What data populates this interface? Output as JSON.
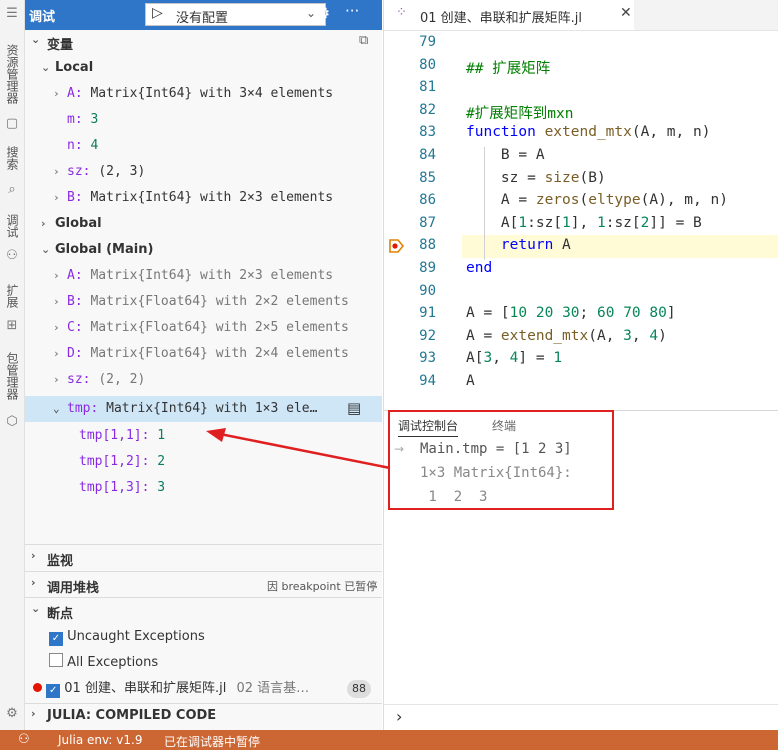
{
  "activity_bar": {
    "labels": [
      "资源管理器",
      "搜索",
      "调试",
      "扩展",
      "包管理器"
    ]
  },
  "debug_toolbar": {
    "title": "调试",
    "config_value": "没有配置"
  },
  "variables": {
    "header": "变量",
    "local_header": "Local",
    "local": [
      {
        "name": "A:",
        "value": "Matrix{Int64} with 3×4 elements"
      },
      {
        "name": "m:",
        "value": "3"
      },
      {
        "name": "n:",
        "value": "4"
      },
      {
        "name": "sz:",
        "value": "(2, 3)"
      },
      {
        "name": "B:",
        "value": "Matrix{Int64} with 2×3 elements"
      }
    ],
    "global_header": "Global",
    "global_main_header": "Global (Main)",
    "global_main": [
      {
        "name": "A:",
        "value": "Matrix{Int64} with 2×3 elements"
      },
      {
        "name": "B:",
        "value": "Matrix{Float64} with 2×2 elements"
      },
      {
        "name": "C:",
        "value": "Matrix{Float64} with 2×5 elements"
      },
      {
        "name": "D:",
        "value": "Matrix{Float64} with 2×4 elements"
      },
      {
        "name": "sz:",
        "value": "(2, 2)"
      }
    ],
    "tmp_row": {
      "name": "tmp:",
      "value": "Matrix{Int64} with 1×3 ele…"
    },
    "tmp_children": [
      {
        "name": "tmp[1,1]:",
        "value": "1"
      },
      {
        "name": "tmp[1,2]:",
        "value": "2"
      },
      {
        "name": "tmp[1,3]:",
        "value": "3"
      }
    ]
  },
  "sections": {
    "watch": "监视",
    "callstack": "调用堆栈",
    "callstack_status": "因 breakpoint 已暂停",
    "breakpoints": "断点",
    "bp_uncaught": "Uncaught Exceptions",
    "bp_all": "All Exceptions",
    "bp_file": "01 创建、串联和扩展矩阵.jl",
    "bp_file_dir": "02 语言基…",
    "bp_line": "88",
    "compiled": "JULIA: COMPILED CODE"
  },
  "editor": {
    "tab_title": "01 创建、串联和扩展矩阵.jl",
    "lines": [
      {
        "n": "79",
        "parts": []
      },
      {
        "n": "80",
        "parts": [
          {
            "t": "## 扩展矩阵",
            "c": "cmt"
          }
        ]
      },
      {
        "n": "81",
        "parts": []
      },
      {
        "n": "82",
        "parts": [
          {
            "t": "#扩展矩阵到mxn",
            "c": "cmt"
          }
        ]
      },
      {
        "n": "83",
        "parts": [
          {
            "t": "function ",
            "c": "kw"
          },
          {
            "t": "extend_mtx",
            "c": "fn"
          },
          {
            "t": "(A, m, n)",
            "c": ""
          }
        ]
      },
      {
        "n": "84",
        "parts": [
          {
            "t": "    B = A",
            "c": ""
          }
        ]
      },
      {
        "n": "85",
        "parts": [
          {
            "t": "    sz = ",
            "c": ""
          },
          {
            "t": "size",
            "c": "fn"
          },
          {
            "t": "(B)",
            "c": ""
          }
        ]
      },
      {
        "n": "86",
        "parts": [
          {
            "t": "    A = ",
            "c": ""
          },
          {
            "t": "zeros",
            "c": "fn"
          },
          {
            "t": "(",
            "c": ""
          },
          {
            "t": "eltype",
            "c": "fn"
          },
          {
            "t": "(A), m, n)",
            "c": ""
          }
        ]
      },
      {
        "n": "87",
        "parts": [
          {
            "t": "    A[",
            "c": ""
          },
          {
            "t": "1",
            "c": "num"
          },
          {
            "t": ":sz[",
            "c": ""
          },
          {
            "t": "1",
            "c": "num"
          },
          {
            "t": "], ",
            "c": ""
          },
          {
            "t": "1",
            "c": "num"
          },
          {
            "t": ":sz[",
            "c": ""
          },
          {
            "t": "2",
            "c": "num"
          },
          {
            "t": "]] = B",
            "c": ""
          }
        ]
      },
      {
        "n": "88",
        "parts": [
          {
            "t": "    ",
            "c": ""
          },
          {
            "t": "return",
            "c": "kw"
          },
          {
            "t": " A",
            "c": ""
          }
        ]
      },
      {
        "n": "89",
        "parts": [
          {
            "t": "end",
            "c": "kw"
          }
        ]
      },
      {
        "n": "90",
        "parts": []
      },
      {
        "n": "91",
        "parts": [
          {
            "t": "A = [",
            "c": ""
          },
          {
            "t": "10",
            "c": "num"
          },
          {
            "t": " ",
            "c": ""
          },
          {
            "t": "20",
            "c": "num"
          },
          {
            "t": " ",
            "c": ""
          },
          {
            "t": "30",
            "c": "num"
          },
          {
            "t": "; ",
            "c": ""
          },
          {
            "t": "60",
            "c": "num"
          },
          {
            "t": " ",
            "c": ""
          },
          {
            "t": "70",
            "c": "num"
          },
          {
            "t": " ",
            "c": ""
          },
          {
            "t": "80",
            "c": "num"
          },
          {
            "t": "]",
            "c": ""
          }
        ]
      },
      {
        "n": "92",
        "parts": [
          {
            "t": "A = ",
            "c": ""
          },
          {
            "t": "extend_mtx",
            "c": "fn"
          },
          {
            "t": "(A, ",
            "c": ""
          },
          {
            "t": "3",
            "c": "num"
          },
          {
            "t": ", ",
            "c": ""
          },
          {
            "t": "4",
            "c": "num"
          },
          {
            "t": ")",
            "c": ""
          }
        ]
      },
      {
        "n": "93",
        "parts": [
          {
            "t": "A[",
            "c": ""
          },
          {
            "t": "3",
            "c": "num"
          },
          {
            "t": ", ",
            "c": ""
          },
          {
            "t": "4",
            "c": "num"
          },
          {
            "t": "] = ",
            "c": ""
          },
          {
            "t": "1",
            "c": "num"
          }
        ]
      },
      {
        "n": "94",
        "parts": [
          {
            "t": "A",
            "c": ""
          }
        ]
      }
    ]
  },
  "panel": {
    "tab_console": "调试控制台",
    "tab_terminal": "终端",
    "output": [
      "Main.tmp = [1 2 3]",
      "1×3 Matrix{Int64}:",
      " 1  2  3"
    ]
  },
  "status_bar": {
    "julia_env": "Julia env: v1.9",
    "state": "已在调试器中暂停"
  },
  "colors": {
    "toolbar_blue": "#2f76c9",
    "status_orange": "#cc6633",
    "highlight_red": "#e02020",
    "current_line": "#fffbd6"
  }
}
